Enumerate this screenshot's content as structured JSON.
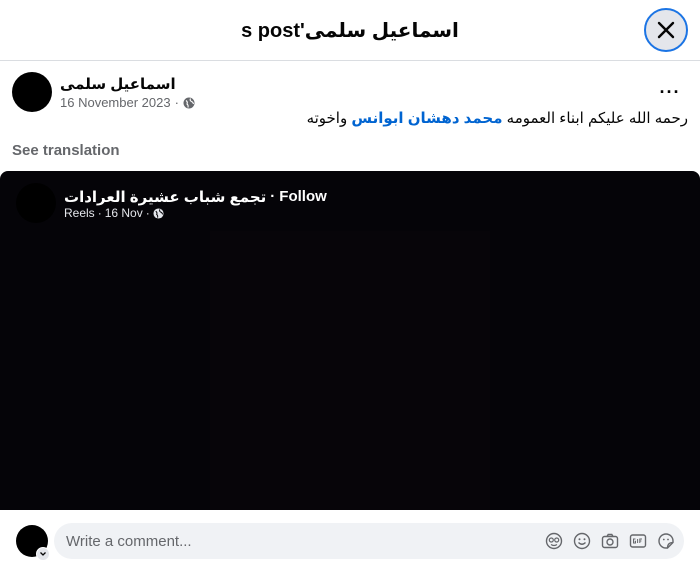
{
  "header": {
    "title": "s post'اسماعيل سلمى"
  },
  "post": {
    "author": "اسماعيل سلمى",
    "date": "16 November 2023",
    "separator": "·",
    "more_label": "···",
    "text_before": "رحمه الله عليكم ابناء العمومه ",
    "mention": "محمد دهشان ابوانس",
    "text_after": "  واخوته",
    "see_translation": "See translation"
  },
  "media": {
    "page_name": "تجمع شباب عشيرة العرادات",
    "dot": "·",
    "follow_label": "Follow",
    "sub_type": "Reels",
    "sub_date": "16 Nov",
    "sub_dot": "·"
  },
  "comment": {
    "placeholder": "Write a comment..."
  },
  "icons": [
    "close-icon",
    "globe-icon",
    "more-icon",
    "avatar-icon",
    "chevron-down-icon",
    "avatar-sticker-icon",
    "emoji-icon",
    "camera-icon",
    "gif-icon",
    "sticker-icon"
  ],
  "colors": {
    "link": "#0064d1",
    "muted": "#65676b",
    "focus": "#1b74e4",
    "media_bg": "#050408"
  }
}
